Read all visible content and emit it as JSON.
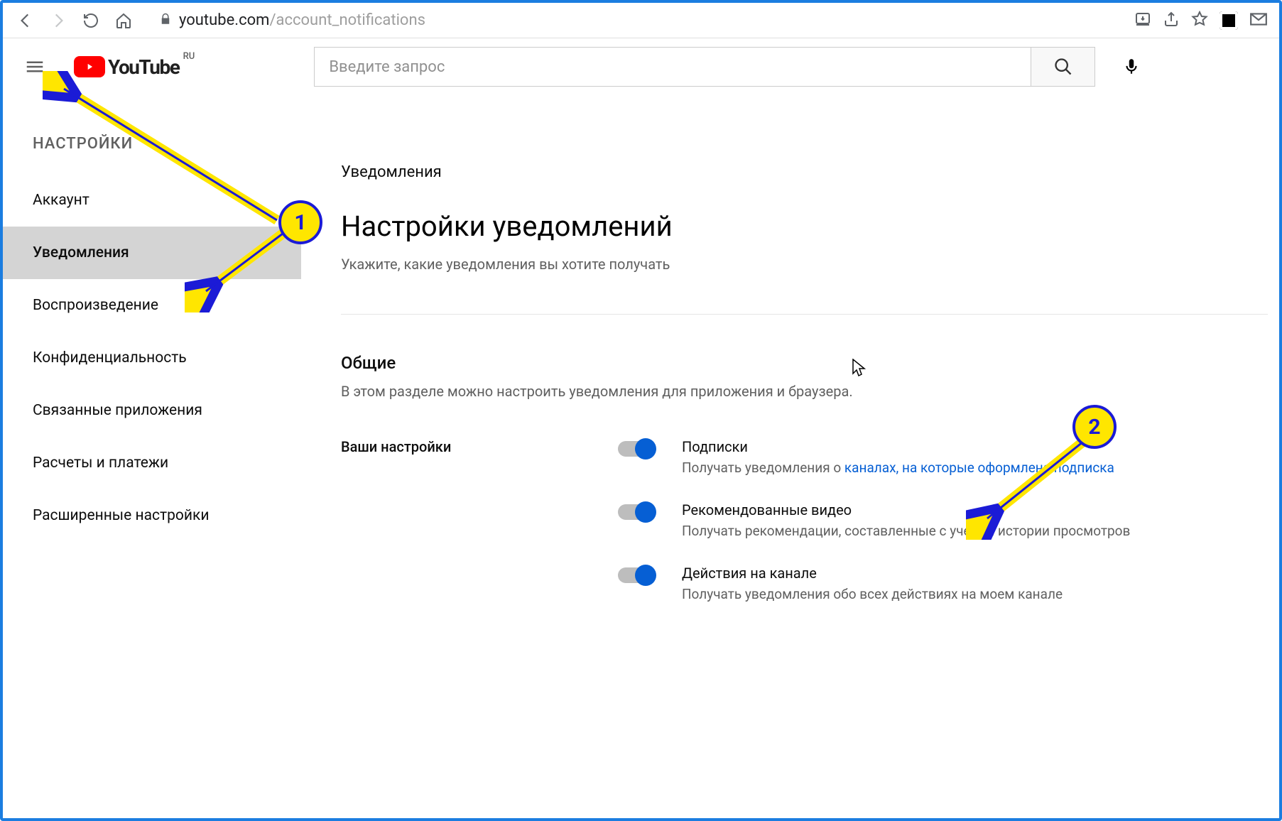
{
  "browser": {
    "url_domain": "youtube.com",
    "url_path": "/account_notifications"
  },
  "header": {
    "logo_text": "YouTube",
    "logo_region": "RU",
    "search_placeholder": "Введите запрос"
  },
  "sidebar": {
    "title": "НАСТРОЙКИ",
    "items": [
      {
        "label": "Аккаунт",
        "active": false
      },
      {
        "label": "Уведомления",
        "active": true
      },
      {
        "label": "Воспроизведение",
        "active": false
      },
      {
        "label": "Конфиденциальность",
        "active": false
      },
      {
        "label": "Связанные приложения",
        "active": false
      },
      {
        "label": "Расчеты и платежи",
        "active": false
      },
      {
        "label": "Расширенные настройки",
        "active": false
      }
    ]
  },
  "main": {
    "section_label": "Уведомления",
    "title": "Настройки уведомлений",
    "subtitle": "Укажите, какие уведомления вы хотите получать",
    "general": {
      "heading": "Общие",
      "desc": "В этом разделе можно настроить уведомления для приложения и браузера.",
      "your_settings_label": "Ваши настройки",
      "toggles": [
        {
          "title": "Подписки",
          "desc_prefix": "Получать уведомления о ",
          "desc_link": "каналах, на которые оформлена подписка",
          "on": true
        },
        {
          "title": "Рекомендованные видео",
          "desc": "Получать рекомендации, составленные с учетом истории просмотров",
          "on": true
        },
        {
          "title": "Действия на канале",
          "desc": "Получать уведомления обо всех действиях на моем канале",
          "on": true
        }
      ]
    }
  },
  "annotations": {
    "marker1": "1",
    "marker2": "2"
  }
}
